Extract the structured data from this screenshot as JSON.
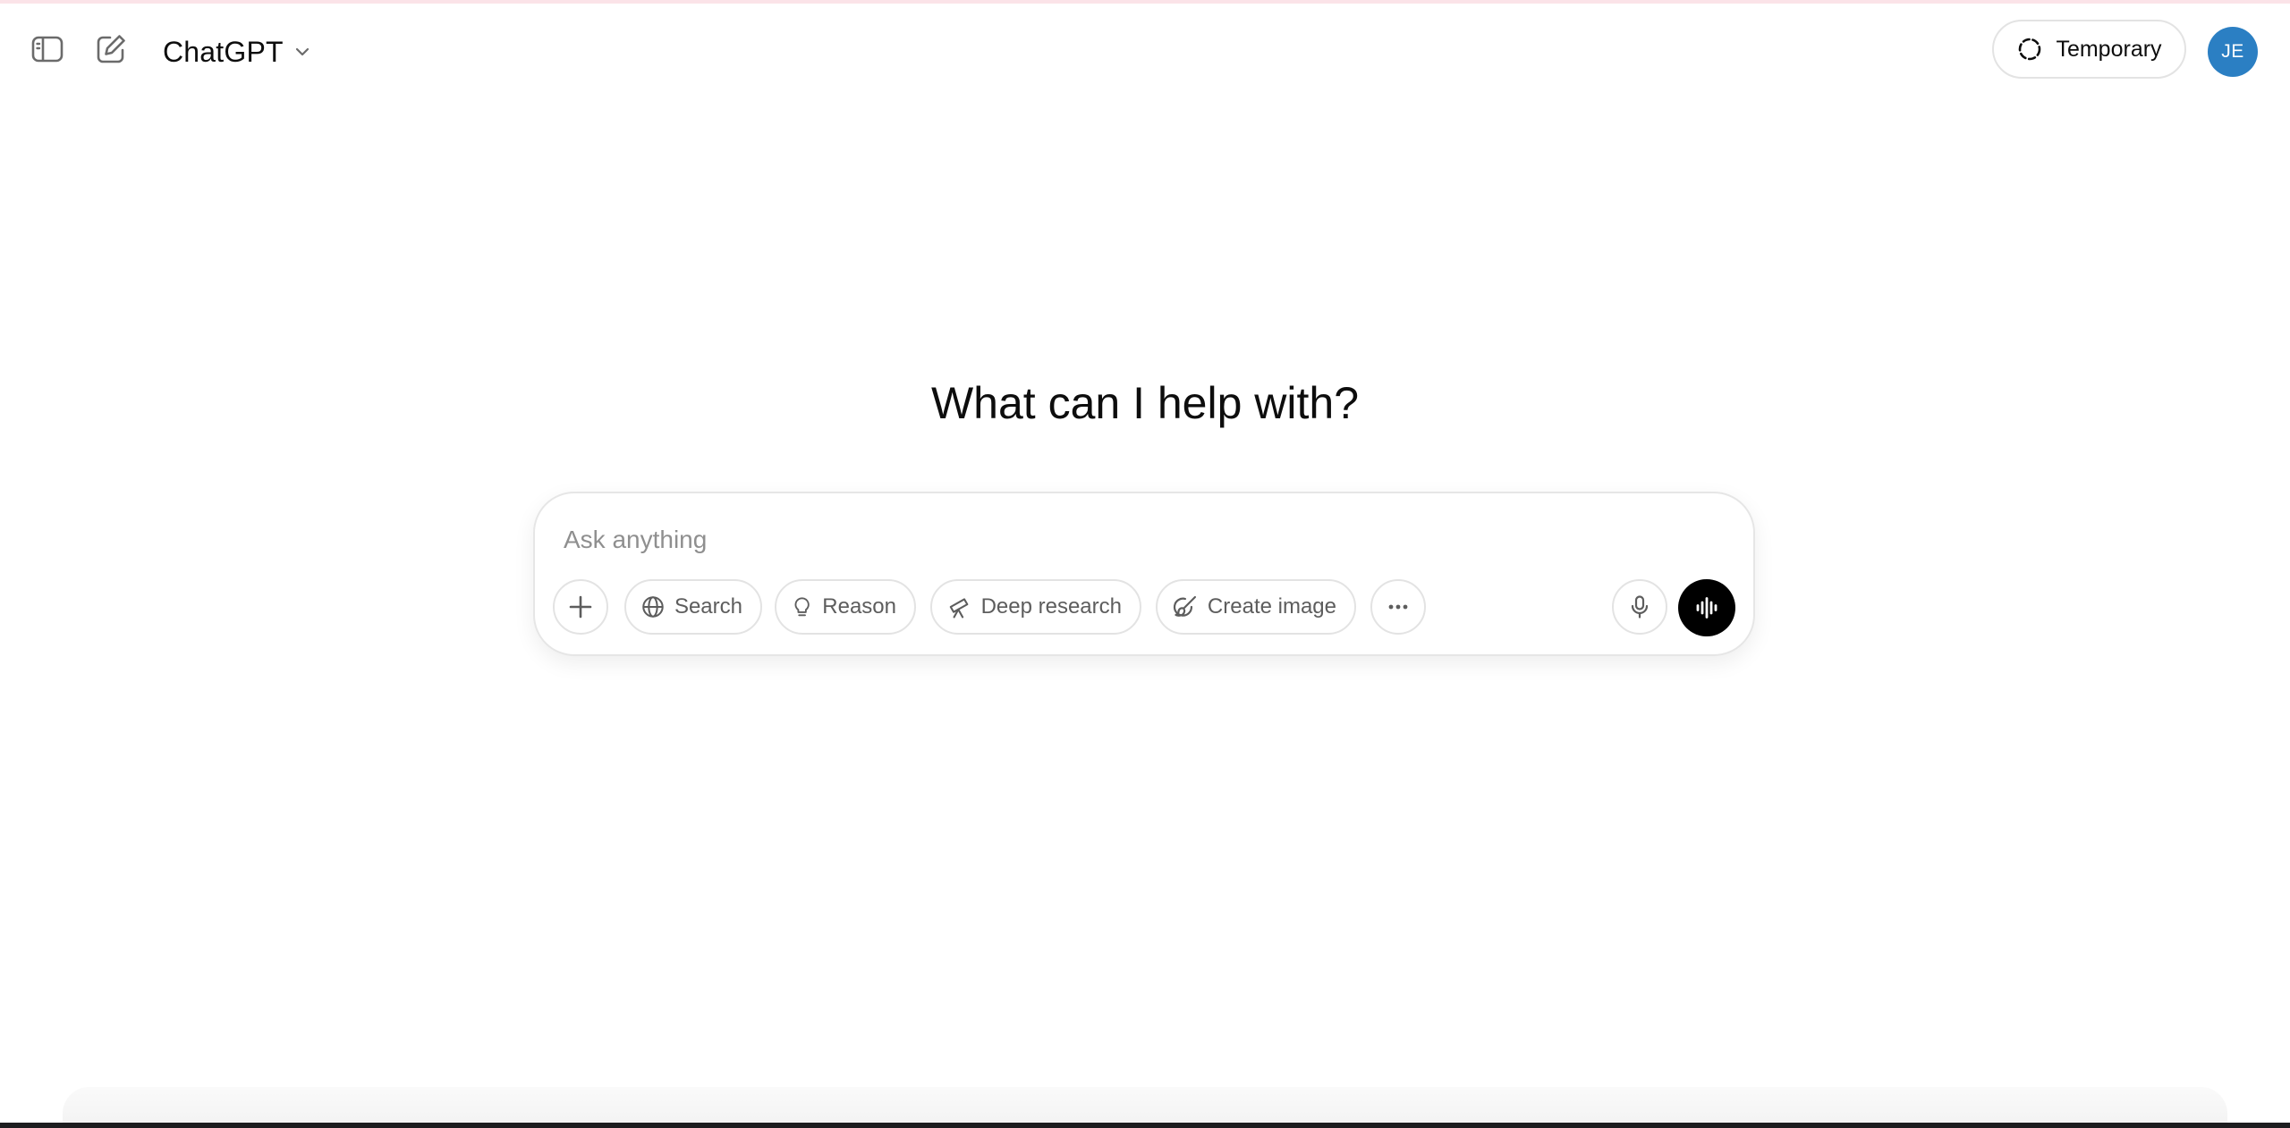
{
  "header": {
    "model_name": "ChatGPT",
    "temporary_label": "Temporary",
    "avatar_initials": "JE",
    "avatar_color": "#2b7fc3"
  },
  "icons": {
    "sidebar_toggle": "sidebar-toggle-icon",
    "new_chat": "new-chat-icon",
    "model_chevron": "chevron-down-icon",
    "temporary": "dashed-circle-icon",
    "attach": "plus-icon",
    "search": "globe-icon",
    "reason": "lightbulb-icon",
    "deep_research": "telescope-icon",
    "create_image": "paint-brush-icon",
    "more": "ellipsis-icon",
    "dictate": "microphone-icon",
    "voice": "voice-waveform-icon"
  },
  "main": {
    "title": "What can I help with?"
  },
  "composer": {
    "placeholder": "Ask anything",
    "value": "",
    "tools": {
      "search": "Search",
      "reason": "Reason",
      "deep_research": "Deep research",
      "create_image": "Create image"
    }
  },
  "colors": {
    "accent_dark": "#000000",
    "text": "#0d0d0d",
    "muted_text": "#5d5d5d",
    "border": "#e3e3e3"
  }
}
